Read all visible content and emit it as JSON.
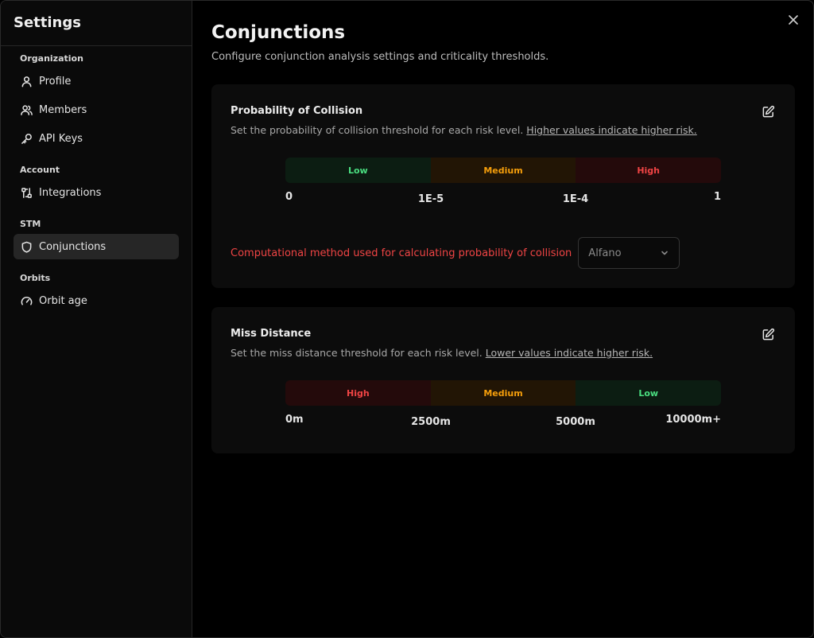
{
  "sidebar": {
    "title": "Settings",
    "sections": [
      {
        "label": "Organization",
        "items": [
          {
            "label": "Profile",
            "icon": "user-icon"
          },
          {
            "label": "Members",
            "icon": "users-icon"
          },
          {
            "label": "API Keys",
            "icon": "key-icon"
          }
        ]
      },
      {
        "label": "Account",
        "items": [
          {
            "label": "Integrations",
            "icon": "integrations-icon"
          }
        ]
      },
      {
        "label": "STM",
        "items": [
          {
            "label": "Conjunctions",
            "icon": "shield-icon",
            "active": true
          }
        ]
      },
      {
        "label": "Orbits",
        "items": [
          {
            "label": "Orbit age",
            "icon": "gauge-icon"
          }
        ]
      }
    ]
  },
  "main": {
    "title": "Conjunctions",
    "subtitle": "Configure conjunction analysis settings and criticality thresholds."
  },
  "poc_card": {
    "title": "Probability of Collision",
    "desc": "Set the probability of collision threshold for each risk level.",
    "desc_link": "Higher values indicate higher risk.",
    "segments": [
      {
        "label": "Low",
        "level": "green"
      },
      {
        "label": "Medium",
        "level": "orange"
      },
      {
        "label": "High",
        "level": "red"
      }
    ],
    "ticks": [
      "0",
      "1E-5",
      "1E-4",
      "1"
    ],
    "method_label": "Computational method used for calculating probability of collision",
    "method_value": "Alfano"
  },
  "miss_card": {
    "title": "Miss Distance",
    "desc": "Set the miss distance threshold for each risk level.",
    "desc_link": "Lower values indicate higher risk.",
    "segments": [
      {
        "label": "High",
        "level": "red"
      },
      {
        "label": "Medium",
        "level": "orange"
      },
      {
        "label": "Low",
        "level": "green"
      }
    ],
    "ticks": [
      "0m",
      "2500m",
      "5000m",
      "10000m+"
    ]
  },
  "colors": {
    "low": "#4ade80",
    "medium": "#f59e0b",
    "high": "#ef4444",
    "active_nav_bg": "#262626"
  }
}
